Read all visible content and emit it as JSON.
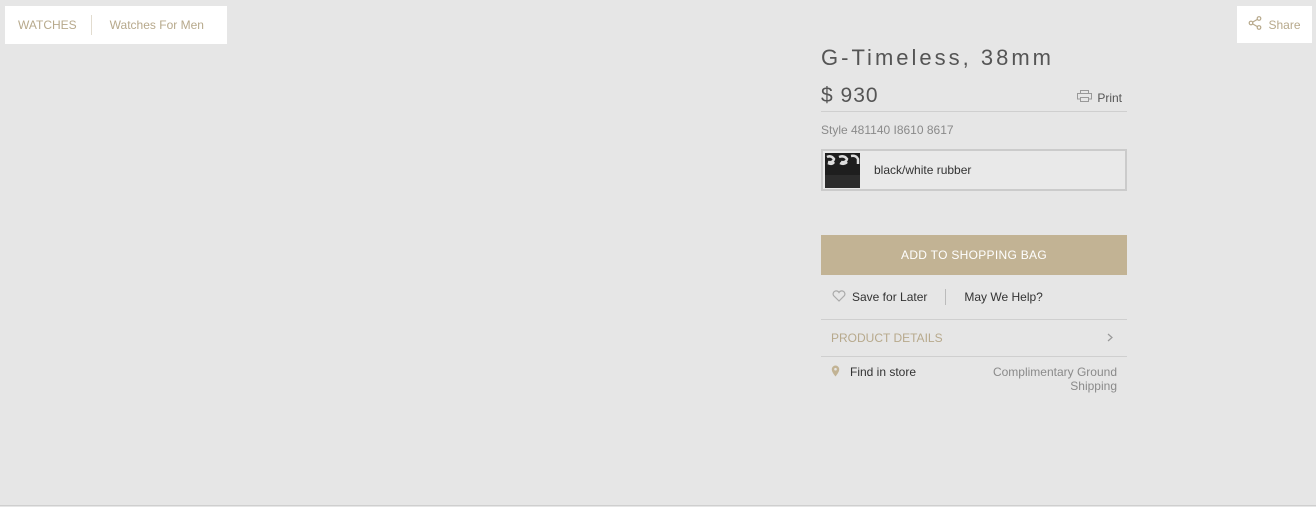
{
  "breadcrumb": {
    "items": [
      "WATCHES",
      "Watches For Men"
    ]
  },
  "share": {
    "label": "Share"
  },
  "product": {
    "title": "G-Timeless, 38mm",
    "price": "$ 930",
    "print_label": "Print",
    "style": "Style 481140 I8610 8617",
    "swatch_label": "black/white rubber"
  },
  "actions": {
    "add_to_bag": "ADD TO SHOPPING BAG",
    "save_for_later": "Save for Later",
    "help": "May We Help?",
    "product_details": "PRODUCT DETAILS",
    "find_in_store": "Find in store",
    "shipping": "Complimentary Ground Shipping"
  },
  "colors": {
    "accent": "#c2b394",
    "link": "#b7a98c",
    "background": "#e6e6e6"
  },
  "icons": [
    "share-icon",
    "print-icon",
    "heart-icon",
    "chevron-right-icon",
    "location-pin-icon"
  ]
}
